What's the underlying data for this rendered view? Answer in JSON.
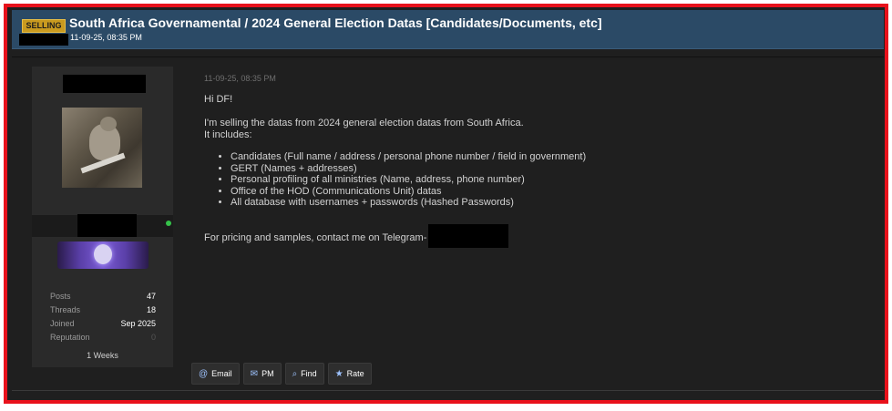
{
  "thread": {
    "badge": "SELLING",
    "title": "South Africa Governamental / 2024 General Election Datas [Candidates/Documents, etc]",
    "date": "11-09-25, 08:35 PM"
  },
  "user": {
    "stats": [
      {
        "label": "Posts",
        "value": "47"
      },
      {
        "label": "Threads",
        "value": "18"
      },
      {
        "label": "Joined",
        "value": "Sep 2025"
      },
      {
        "label": "Reputation",
        "value": "0"
      }
    ],
    "tenure": "1 Weeks"
  },
  "post": {
    "date": "11-09-25, 08:35 PM",
    "greeting": "Hi DF!",
    "intro_line1": "I'm selling the datas from 2024 general election datas from South Africa.",
    "intro_line2": "It includes:",
    "items": [
      "Candidates (Full name / address / personal phone number / field in government)",
      "GERT (Names + addresses)",
      "Personal profiling of all ministries (Name, address, phone number)",
      "Office of the HOD (Communications Unit) datas",
      "All database with usernames + passwords (Hashed Passwords)"
    ],
    "contact": "For pricing and samples, contact me on Telegram-"
  },
  "actions": [
    {
      "label": "Email",
      "icon": "at-icon",
      "glyph": "@"
    },
    {
      "label": "PM",
      "icon": "envelope-icon",
      "glyph": "✉"
    },
    {
      "label": "Find",
      "icon": "search-icon",
      "glyph": "⌕"
    },
    {
      "label": "Rate",
      "icon": "star-icon",
      "glyph": "★"
    }
  ],
  "colors": {
    "frame": "#e8111b",
    "header": "#2b4a66",
    "badge": "#c99a1f",
    "online": "#35c24a"
  }
}
